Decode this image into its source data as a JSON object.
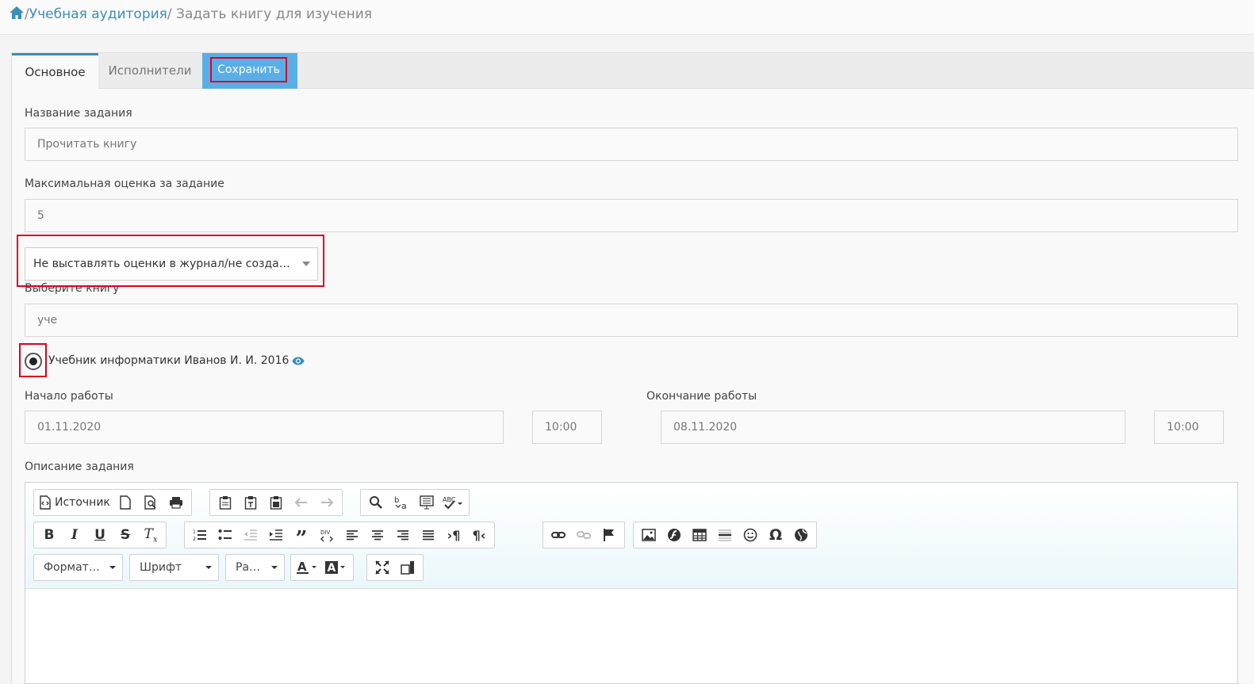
{
  "breadcrumb": {
    "home_icon": "home-icon",
    "sep1": "/",
    "link": "Учебная аудитория",
    "sep2": "/",
    "current": "Задать книгу для изучения"
  },
  "tabs": {
    "main": "Основное",
    "executors": "Исполнители",
    "save": "Сохранить"
  },
  "form": {
    "task_name_label": "Название задания",
    "task_name_value": "Прочитать книгу",
    "max_grade_label": "Максимальная оценка за задание",
    "max_grade_value": "5",
    "grading_select": "Не выставлять оценки в журнал/не создават…",
    "book_label": "Выберите книгу",
    "book_search_value": "уче",
    "book_option": "Учебник информатики Иванов И. И. 2016",
    "start_label": "Начало работы",
    "start_date": "01.11.2020",
    "start_time": "10:00",
    "end_label": "Окончание работы",
    "end_date": "08.11.2020",
    "end_time": "10:00",
    "description_label": "Описание задания"
  },
  "editor": {
    "source_label": "Источник",
    "format_combo": "Формат…",
    "font_combo": "Шрифт",
    "size_combo": "Ра…"
  },
  "colors": {
    "accent": "#3c8dbc",
    "save_tab": "#5aaee8",
    "highlight": "#e0001b"
  }
}
